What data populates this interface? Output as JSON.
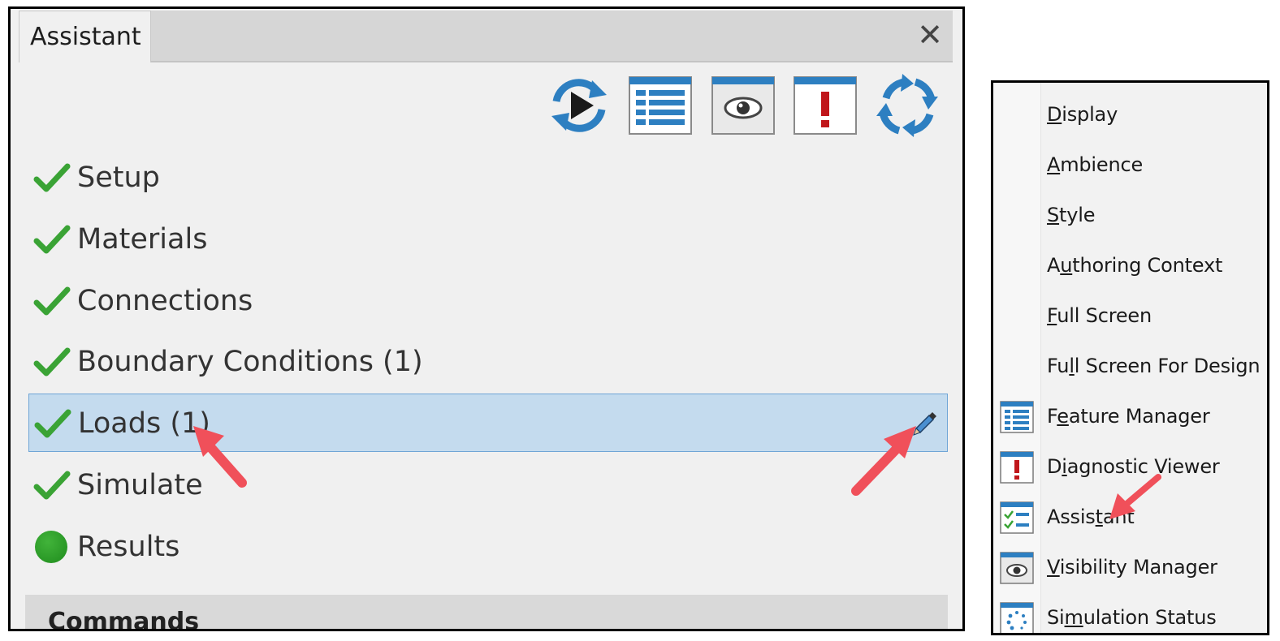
{
  "panel": {
    "tab_label": "Assistant",
    "close_glyph": "✕",
    "toolbar": [
      {
        "name": "run-icon"
      },
      {
        "name": "feature-manager-icon"
      },
      {
        "name": "visibility-icon"
      },
      {
        "name": "diagnostic-icon"
      },
      {
        "name": "refresh-icon"
      }
    ],
    "steps": [
      {
        "label": "Setup",
        "status": "check"
      },
      {
        "label": "Materials",
        "status": "check"
      },
      {
        "label": "Connections",
        "status": "check"
      },
      {
        "label": "Boundary Conditions (1)",
        "status": "check"
      },
      {
        "label": "Loads (1)",
        "status": "check",
        "selected": true
      },
      {
        "label": "Simulate",
        "status": "check"
      },
      {
        "label": "Results",
        "status": "dot"
      }
    ],
    "commands_label": "Commands"
  },
  "menu": {
    "items": [
      {
        "label": "Display",
        "accel": "D",
        "icon": ""
      },
      {
        "label": "Ambience",
        "accel": "A",
        "icon": ""
      },
      {
        "label": "Style",
        "accel": "S",
        "icon": ""
      },
      {
        "label": "Authoring Context",
        "accel": "u",
        "icon": ""
      },
      {
        "label": "Full Screen",
        "accel": "F",
        "icon": ""
      },
      {
        "label": "Full Screen For Design",
        "accel": "l",
        "icon": ""
      },
      {
        "label": "Feature Manager",
        "accel": "e",
        "icon": "feature-manager-icon"
      },
      {
        "label": "Diagnostic Viewer",
        "accel": "i",
        "icon": "diagnostic-icon"
      },
      {
        "label": "Assistant",
        "accel": "t",
        "icon": "assistant-icon"
      },
      {
        "label": "Visibility Manager",
        "accel": "V",
        "icon": "visibility-icon"
      },
      {
        "label": "Simulation Status",
        "accel": "m",
        "icon": "simulation-status-icon"
      }
    ]
  },
  "colors": {
    "check": "#3aa335",
    "selection_bg": "#c4dbee",
    "selection_border": "#6fa5d6",
    "arrow": "#f0505a",
    "icon_blue": "#2d7fc1"
  }
}
